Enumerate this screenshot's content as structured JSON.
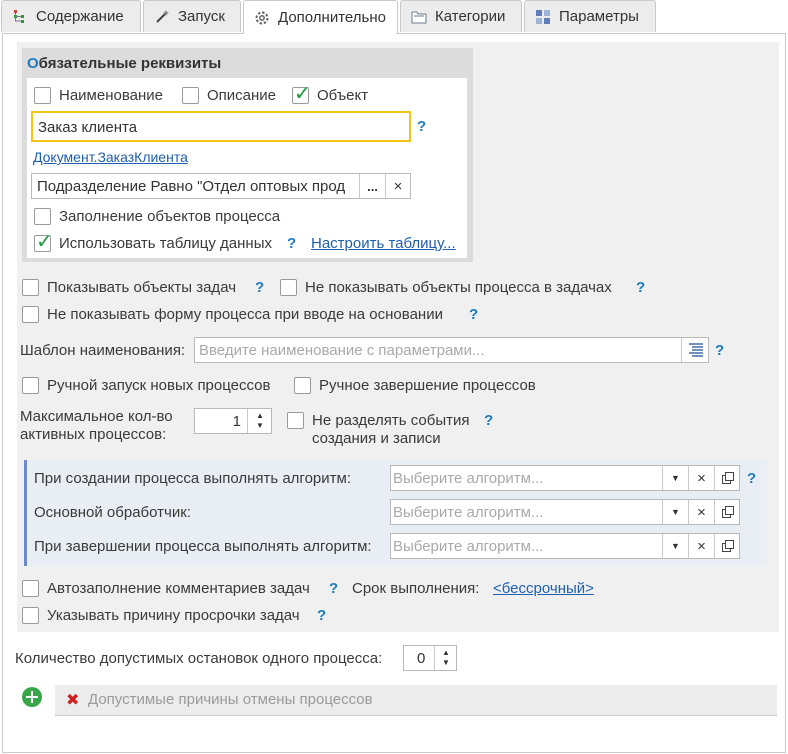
{
  "tabs": [
    {
      "label": "Содержание",
      "icon": "tree-icon"
    },
    {
      "label": "Запуск",
      "icon": "magic-wand-icon"
    },
    {
      "label": "Дополнительно",
      "icon": "gear-icon",
      "active": true
    },
    {
      "label": "Категории",
      "icon": "folder-icon"
    },
    {
      "label": "Параметры",
      "icon": "grid-icon"
    }
  ],
  "required": {
    "title_first": "О",
    "title_rest": "бязательные реквизиты",
    "name_label": "Наименование",
    "name_checked": false,
    "desc_label": "Описание",
    "desc_checked": false,
    "object_label": "Объект",
    "object_checked": true,
    "object_value": "Заказ клиента",
    "object_type_link": "Документ.ЗаказКлиента",
    "filter_value": "Подразделение Равно \"Отдел оптовых прод",
    "filter_dots": "...",
    "filter_clear": "×",
    "fill_label": "Заполнение объектов процесса",
    "fill_checked": false,
    "use_table_label": "Использовать таблицу данных",
    "use_table_checked": true,
    "configure_table_link": "Настроить таблицу..."
  },
  "options": {
    "show_task_objects": "Показывать объекты задач",
    "hide_process_objects": "Не показывать объекты процесса в задачах",
    "hide_form_on_basis": "Не показывать форму процесса при вводе на основании",
    "name_template_label": "Шаблон наименования:",
    "name_template_placeholder": "Введите наименование с параметрами...",
    "manual_start": "Ручной запуск новых процессов",
    "manual_finish": "Ручное завершение процессов",
    "max_active_label_1": "Максимальное кол-во",
    "max_active_label_2": "активных процессов:",
    "max_active_value": "1",
    "no_split_events_1": "Не разделять события",
    "no_split_events_2": "создания и записи"
  },
  "algorithms": {
    "on_create_label": "При создании процесса выполнять алгоритм:",
    "main_handler_label": "Основной обработчик:",
    "on_finish_label": "При завершении процесса выполнять алгоритм:",
    "placeholder": "Выберите алгоритм..."
  },
  "bottom": {
    "autofill_comments": "Автозаполнение комментариев задач",
    "deadline_label": "Срок выполнения:",
    "deadline_value": "<бессрочный>",
    "overdue_reason": "Указывать причину просрочки задач",
    "stops_label": "Количество допустимых остановок одного процесса:",
    "stops_value": "0",
    "cancel_reasons_label": "Допустимые причины отмены процессов"
  },
  "help_mark": "?",
  "colors": {
    "accent": "#1a7bc0",
    "check": "#1a9a3a",
    "link": "#1f5fb0",
    "band": "#6f88c7",
    "highlight": "#f2c418"
  }
}
